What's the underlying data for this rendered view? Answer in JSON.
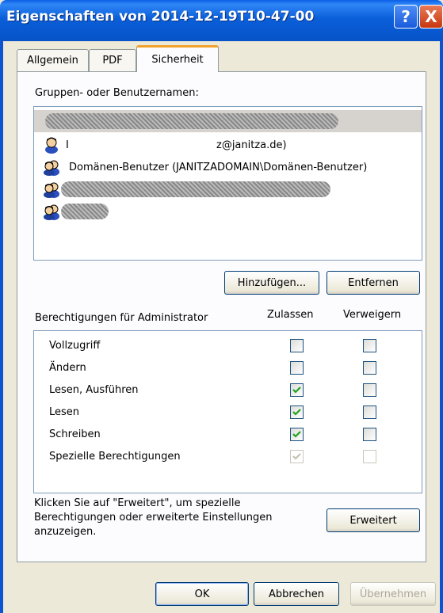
{
  "window": {
    "title": "Eigenschaften von 2014-12-19T10-47-00",
    "help_glyph": "?",
    "close_glyph": "X"
  },
  "tabs": [
    {
      "label": "Allgemein"
    },
    {
      "label": "PDF"
    },
    {
      "label": "Sicherheit",
      "selected": true
    }
  ],
  "groups": {
    "label": "Gruppen- oder Benutzernamen:",
    "entries": [
      {
        "text": "",
        "redacted": true,
        "selected": true,
        "icon": "user-icon"
      },
      {
        "text": "z@janitza.de)",
        "redacted": false,
        "icon": "user-icon"
      },
      {
        "text": "Domänen-Benutzer (JANITZADOMAIN\\Domänen-Benutzer)",
        "redacted": false,
        "icon": "group-icon"
      },
      {
        "text": "",
        "redacted": true,
        "icon": "group-icon"
      },
      {
        "text": "",
        "redacted": true,
        "icon": "group-icon"
      }
    ],
    "add_label": "Hinzufügen...",
    "remove_label": "Entfernen"
  },
  "permissions": {
    "header": "Berechtigungen für Administrator",
    "allow_header": "Zulassen",
    "deny_header": "Verweigern",
    "rows": [
      {
        "name": "Vollzugriff",
        "allow": false,
        "deny": false,
        "disabled": false
      },
      {
        "name": "Ändern",
        "allow": false,
        "deny": false,
        "disabled": false
      },
      {
        "name": "Lesen, Ausführen",
        "allow": true,
        "deny": false,
        "disabled": false
      },
      {
        "name": "Lesen",
        "allow": true,
        "deny": false,
        "disabled": false
      },
      {
        "name": "Schreiben",
        "allow": true,
        "deny": false,
        "disabled": false
      },
      {
        "name": "Spezielle Berechtigungen",
        "allow": true,
        "deny": false,
        "disabled": true
      }
    ]
  },
  "advanced": {
    "hint_line1": "Klicken Sie auf \"Erweitert\", um spezielle",
    "hint_line2": "Berechtigungen oder erweiterte Einstellungen",
    "hint_line3": "anzuzeigen.",
    "button_label": "Erweitert"
  },
  "footer": {
    "ok_label": "OK",
    "cancel_label": "Abbrechen",
    "apply_label": "Übernehmen"
  },
  "colors": {
    "titlebar": "#0a5fd9",
    "selected_tab_accent": "#f1a12d",
    "check": "#21a121"
  }
}
